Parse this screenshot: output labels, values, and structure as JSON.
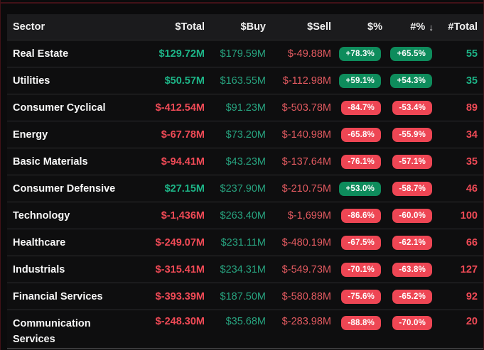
{
  "table": {
    "columns": [
      {
        "label": "Sector"
      },
      {
        "label": "$Total"
      },
      {
        "label": "$Buy"
      },
      {
        "label": "$Sell"
      },
      {
        "label": "$%"
      },
      {
        "label": "#%",
        "sorted": "desc"
      },
      {
        "label": "#Total"
      }
    ],
    "sort_icon": "↓",
    "rows": [
      {
        "sector": "Real Estate",
        "total": "$129.72M",
        "total_dir": "pos",
        "buy": "$179.59M",
        "sell": "$-49.88M",
        "dollar_pct": "+78.3%",
        "dollar_pct_dir": "pos",
        "num_pct": "+65.5%",
        "num_pct_dir": "pos",
        "num_total": "55",
        "num_total_dir": "pos"
      },
      {
        "sector": "Utilities",
        "total": "$50.57M",
        "total_dir": "pos",
        "buy": "$163.55M",
        "sell": "$-112.98M",
        "dollar_pct": "+59.1%",
        "dollar_pct_dir": "pos",
        "num_pct": "+54.3%",
        "num_pct_dir": "pos",
        "num_total": "35",
        "num_total_dir": "pos"
      },
      {
        "sector": "Consumer Cyclical",
        "total": "$-412.54M",
        "total_dir": "neg",
        "buy": "$91.23M",
        "sell": "$-503.78M",
        "dollar_pct": "-84.7%",
        "dollar_pct_dir": "neg",
        "num_pct": "-53.4%",
        "num_pct_dir": "neg",
        "num_total": "89",
        "num_total_dir": "neg"
      },
      {
        "sector": "Energy",
        "total": "$-67.78M",
        "total_dir": "neg",
        "buy": "$73.20M",
        "sell": "$-140.98M",
        "dollar_pct": "-65.8%",
        "dollar_pct_dir": "neg",
        "num_pct": "-55.9%",
        "num_pct_dir": "neg",
        "num_total": "34",
        "num_total_dir": "neg"
      },
      {
        "sector": "Basic Materials",
        "total": "$-94.41M",
        "total_dir": "neg",
        "buy": "$43.23M",
        "sell": "$-137.64M",
        "dollar_pct": "-76.1%",
        "dollar_pct_dir": "neg",
        "num_pct": "-57.1%",
        "num_pct_dir": "neg",
        "num_total": "35",
        "num_total_dir": "neg"
      },
      {
        "sector": "Consumer Defensive",
        "total": "$27.15M",
        "total_dir": "pos",
        "buy": "$237.90M",
        "sell": "$-210.75M",
        "dollar_pct": "+53.0%",
        "dollar_pct_dir": "pos",
        "num_pct": "-58.7%",
        "num_pct_dir": "neg",
        "num_total": "46",
        "num_total_dir": "neg"
      },
      {
        "sector": "Technology",
        "total": "$-1,436M",
        "total_dir": "neg",
        "buy": "$263.40M",
        "sell": "$-1,699M",
        "dollar_pct": "-86.6%",
        "dollar_pct_dir": "neg",
        "num_pct": "-60.0%",
        "num_pct_dir": "neg",
        "num_total": "100",
        "num_total_dir": "neg"
      },
      {
        "sector": "Healthcare",
        "total": "$-249.07M",
        "total_dir": "neg",
        "buy": "$231.11M",
        "sell": "$-480.19M",
        "dollar_pct": "-67.5%",
        "dollar_pct_dir": "neg",
        "num_pct": "-62.1%",
        "num_pct_dir": "neg",
        "num_total": "66",
        "num_total_dir": "neg"
      },
      {
        "sector": "Industrials",
        "total": "$-315.41M",
        "total_dir": "neg",
        "buy": "$234.31M",
        "sell": "$-549.73M",
        "dollar_pct": "-70.1%",
        "dollar_pct_dir": "neg",
        "num_pct": "-63.8%",
        "num_pct_dir": "neg",
        "num_total": "127",
        "num_total_dir": "neg"
      },
      {
        "sector": "Financial Services",
        "total": "$-393.39M",
        "total_dir": "neg",
        "buy": "$187.50M",
        "sell": "$-580.88M",
        "dollar_pct": "-75.6%",
        "dollar_pct_dir": "neg",
        "num_pct": "-65.2%",
        "num_pct_dir": "neg",
        "num_total": "92",
        "num_total_dir": "neg"
      },
      {
        "sector": "Communication Services",
        "total": "$-248.30M",
        "total_dir": "neg",
        "buy": "$35.68M",
        "sell": "$-283.98M",
        "dollar_pct": "-88.8%",
        "dollar_pct_dir": "neg",
        "num_pct": "-70.0%",
        "num_pct_dir": "neg",
        "num_total": "20",
        "num_total_dir": "neg"
      }
    ]
  },
  "colors": {
    "positive_text": "#1db487",
    "positive_text_dim": "#27a37f",
    "negative_text": "#ef4a56",
    "negative_text_dim": "#e25a60",
    "badge_positive_bg": "#0e8c5c",
    "badge_negative_bg": "#ee4654",
    "frame_accent": "#421218",
    "header_bg": "#1b1b1d",
    "row_bg": "#0e0e0f"
  }
}
